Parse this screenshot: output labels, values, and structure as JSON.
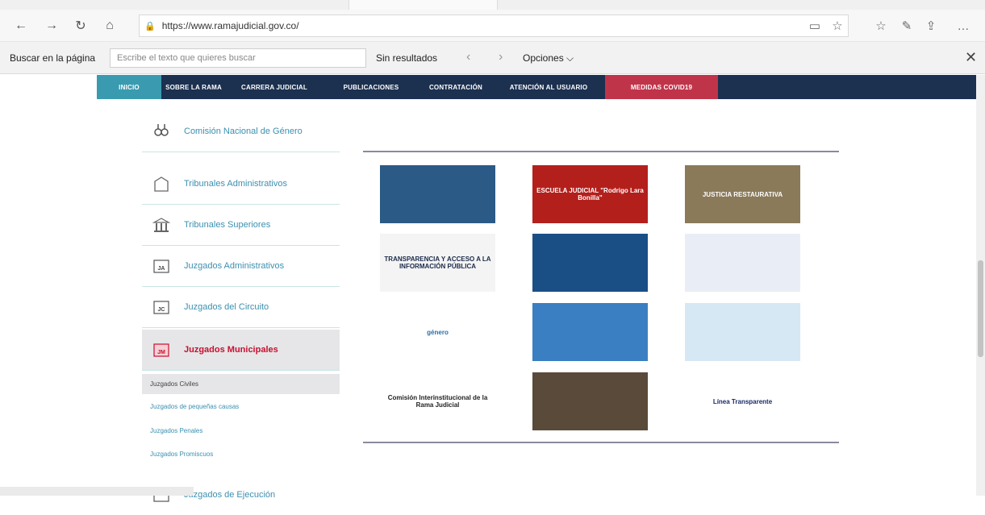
{
  "browser": {
    "url": "https://www.ramajudicial.gov.co/",
    "icons": [
      "back-icon",
      "forward-icon",
      "refresh-icon",
      "home-icon",
      "lock-icon",
      "reading-view-icon",
      "favorite-icon",
      "favorites-list-icon",
      "pen-icon",
      "share-icon",
      "more-icon"
    ]
  },
  "findbar": {
    "label": "Buscar en la página",
    "placeholder": "Escribe el texto que quieres buscar",
    "result": "Sin resultados",
    "options": "Opciones ⌵"
  },
  "site_nav": {
    "items": [
      {
        "label": "Inicio",
        "color": "#3a9bb0"
      },
      {
        "label": "Sobre la Rama",
        "color": "#1c3050"
      },
      {
        "label": "Carrera Judicial",
        "color": "#1c3050"
      },
      {
        "label": "Publicaciones",
        "color": "#1c3050"
      },
      {
        "label": "Contratación",
        "color": "#1c3050"
      },
      {
        "label": "Atención al Usuario",
        "color": "#1c3050"
      },
      {
        "label": "Medidas Covid19",
        "color": "#c0344a"
      }
    ]
  },
  "sidebar": {
    "items": [
      {
        "label": "Comisión Nacional de Género",
        "icon": "gender-icon"
      },
      {
        "label": "Tribunales Administrativos",
        "icon": "building-icon"
      },
      {
        "label": "Tribunales Superiores",
        "icon": "columns-icon"
      },
      {
        "label": "Juzgados Administrativos",
        "icon": "folder-ja-icon",
        "abbr": "JA"
      },
      {
        "label": "Juzgados del Circuito",
        "icon": "folder-jc-icon",
        "abbr": "JC"
      },
      {
        "label": "Juzgados Municipales",
        "icon": "folder-jm-icon",
        "abbr": "JM"
      }
    ],
    "subitems": [
      "Juzgados Civiles",
      "Juzgados de pequeñas causas",
      "Juzgados Penales",
      "Juzgados Promiscuos"
    ],
    "last_item": "Juzgados de Ejecución"
  },
  "tiles": [
    {
      "text": "",
      "bg": "#2b5a86",
      "fg": "#ffffff"
    },
    {
      "text": "ESCUELA JUDICIAL \"Rodrigo Lara Bonilla\"",
      "bg": "#b3201c",
      "fg": "#ffffff"
    },
    {
      "text": "JUSTICIA RESTAURATIVA",
      "bg": "#8a7a5a",
      "fg": "#ffffff"
    },
    {
      "text": "TRANSPARENCIA Y ACCESO A LA INFORMACIÓN PÚBLICA",
      "bg": "#f4f4f4",
      "fg": "#1a2a4a"
    },
    {
      "text": "",
      "bg": "#1a4f86",
      "fg": "#ffffff"
    },
    {
      "text": "",
      "bg": "#e9eef6",
      "fg": "#1a4f86"
    },
    {
      "text": "género",
      "bg": "#ffffff",
      "fg": "#2a6fa8"
    },
    {
      "text": "",
      "bg": "#3a7fc2",
      "fg": "#ffffff"
    },
    {
      "text": "",
      "bg": "#d6e8f4",
      "fg": "#333333"
    },
    {
      "text": "Comisión Interinstitucional de la Rama Judicial",
      "bg": "#ffffff",
      "fg": "#222222"
    },
    {
      "text": "",
      "bg": "#5a4a3a",
      "fg": "#ffffff"
    },
    {
      "text": "Línea Transparente",
      "bg": "#ffffff",
      "fg": "#1a2a6a"
    }
  ]
}
